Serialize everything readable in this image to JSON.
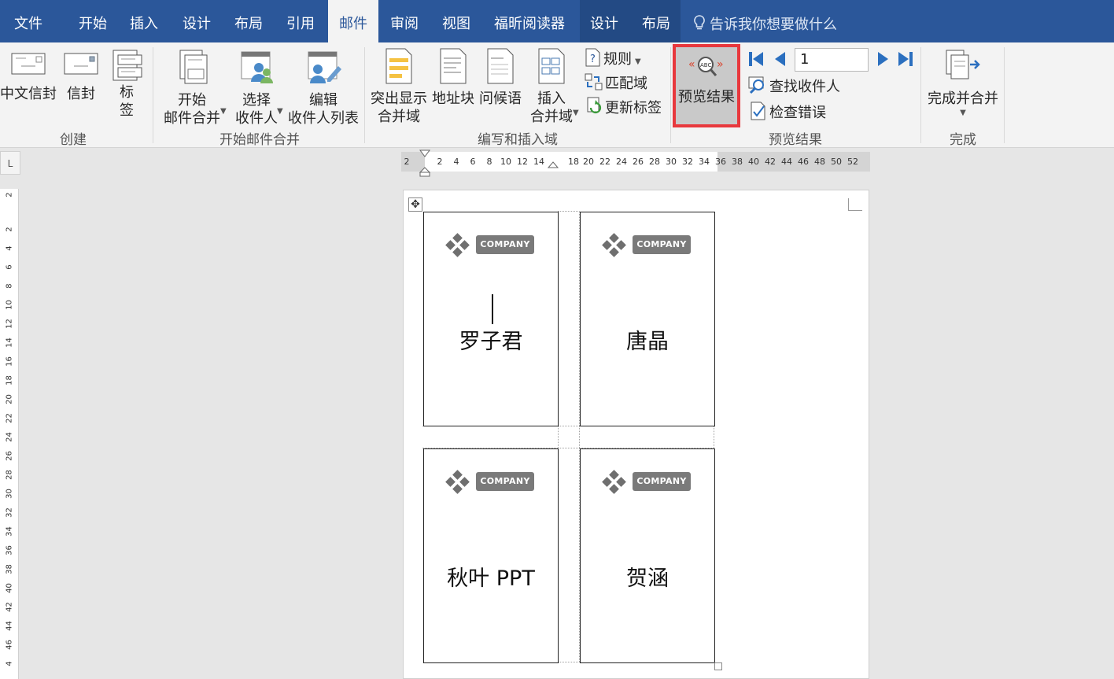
{
  "tabs": [
    "文件",
    "开始",
    "插入",
    "设计",
    "布局",
    "引用",
    "邮件",
    "审阅",
    "视图",
    "福昕阅读器",
    "设计",
    "布局"
  ],
  "tell_me": "告诉我你想要做什么",
  "ribbon": {
    "create": {
      "label": "创建",
      "chinese_envelope": "中文信封",
      "envelope": "信封",
      "labels": "标\n签"
    },
    "start_merge": {
      "label": "开始邮件合并",
      "start": "开始\n邮件合并",
      "select": "选择\n收件人",
      "edit": "编辑\n收件人列表"
    },
    "write_insert": {
      "label": "编写和插入域",
      "highlight": "突出显示\n合并域",
      "address": "地址块",
      "greeting": "问候语",
      "insert_field": "插入\n合并域",
      "rules": "规则",
      "match": "匹配域",
      "update": "更新标签"
    },
    "preview": {
      "label": "预览结果",
      "preview_btn": "预览结果",
      "record": "1",
      "find": "查找收件人",
      "check": "检查错误"
    },
    "finish": {
      "label": "完成",
      "finish_merge": "完成并合并"
    }
  },
  "ruler": {
    "horizontal": [
      "2",
      "2",
      "4",
      "6",
      "8",
      "10",
      "12",
      "14",
      "18",
      "20",
      "22",
      "24",
      "26",
      "28",
      "30",
      "32",
      "34",
      "36",
      "38",
      "40",
      "42",
      "44",
      "46",
      "48",
      "50",
      "52"
    ],
    "vertical": [
      "2",
      "2",
      "4",
      "6",
      "8",
      "10",
      "12",
      "14",
      "16",
      "18",
      "20",
      "22",
      "24",
      "26",
      "28",
      "30",
      "32",
      "34",
      "36",
      "38",
      "40",
      "42",
      "44",
      "46",
      "4"
    ],
    "corner": "L"
  },
  "labels": [
    {
      "logo_text": "COMPANY",
      "name": "罗子君"
    },
    {
      "logo_text": "COMPANY",
      "name": "唐晶"
    },
    {
      "logo_text": "COMPANY",
      "name": "秋叶 PPT"
    },
    {
      "logo_text": "COMPANY",
      "name": "贺涵"
    }
  ],
  "colors": {
    "tab_bar": "#2b579a",
    "highlight_box": "#e8383d",
    "nav_arrow": "#2b6fbf"
  }
}
